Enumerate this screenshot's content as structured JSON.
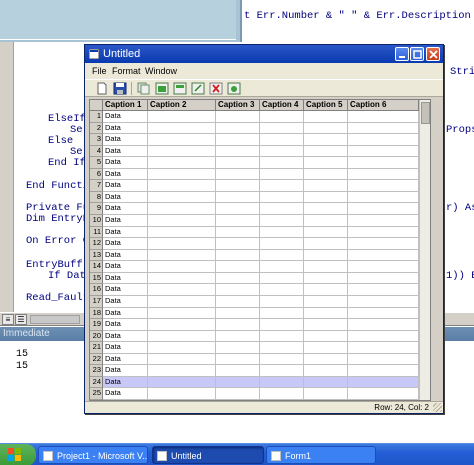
{
  "ide": {
    "code_lines": [
      "t Err.Number & \" \" & Err.Description",
      "Stri",
      "ElseIf",
      "Se",
      "Propse",
      "Else",
      "Se",
      "End If",
      "End Function",
      "Private Fu",
      "r) As",
      "Dim EntryBu",
      "On Error Go",
      "EntryBuff",
      "If Dat",
      "1)) E",
      "Read_Fault"
    ],
    "immediate": {
      "title": "Immediate",
      "lines": [
        "15",
        "15"
      ]
    }
  },
  "window": {
    "title": "Untitled",
    "menu": [
      "File",
      "Format",
      "Window"
    ],
    "toolbar_icons": [
      "new-file-icon",
      "save-icon",
      "copy-icon",
      "paste-icon",
      "edit-icon",
      "cut-icon",
      "delete-icon",
      "refresh-icon"
    ],
    "grid": {
      "columns": [
        "Caption 1",
        "Caption 2",
        "Caption 3",
        "Caption 4",
        "Caption 5",
        "Caption 6"
      ],
      "rows": [
        {
          "n": "1",
          "c1": "Data"
        },
        {
          "n": "2",
          "c1": "Data"
        },
        {
          "n": "3",
          "c1": "Data"
        },
        {
          "n": "4",
          "c1": "Data"
        },
        {
          "n": "5",
          "c1": "Data"
        },
        {
          "n": "6",
          "c1": "Data"
        },
        {
          "n": "7",
          "c1": "Data"
        },
        {
          "n": "8",
          "c1": "Data"
        },
        {
          "n": "9",
          "c1": "Data"
        },
        {
          "n": "10",
          "c1": "Data"
        },
        {
          "n": "11",
          "c1": "Data"
        },
        {
          "n": "12",
          "c1": "Data"
        },
        {
          "n": "13",
          "c1": "Data"
        },
        {
          "n": "14",
          "c1": "Data"
        },
        {
          "n": "15",
          "c1": "Data"
        },
        {
          "n": "16",
          "c1": "Data"
        },
        {
          "n": "17",
          "c1": "Data"
        },
        {
          "n": "18",
          "c1": "Data"
        },
        {
          "n": "19",
          "c1": "Data"
        },
        {
          "n": "20",
          "c1": "Data"
        },
        {
          "n": "21",
          "c1": "Data"
        },
        {
          "n": "22",
          "c1": "Data"
        },
        {
          "n": "23",
          "c1": "Data"
        },
        {
          "n": "24",
          "c1": "Data"
        },
        {
          "n": "25",
          "c1": "Data"
        }
      ],
      "selected_row": "24"
    },
    "status": "Row: 24, Col: 2"
  },
  "taskbar": {
    "buttons": [
      "Project1 - Microsoft V...",
      "Untitled",
      "Form1"
    ]
  },
  "colors": {
    "title_bar": "#0a3ab0",
    "selected_row": "#c8c8f8",
    "taskbar": "#245ed6"
  }
}
